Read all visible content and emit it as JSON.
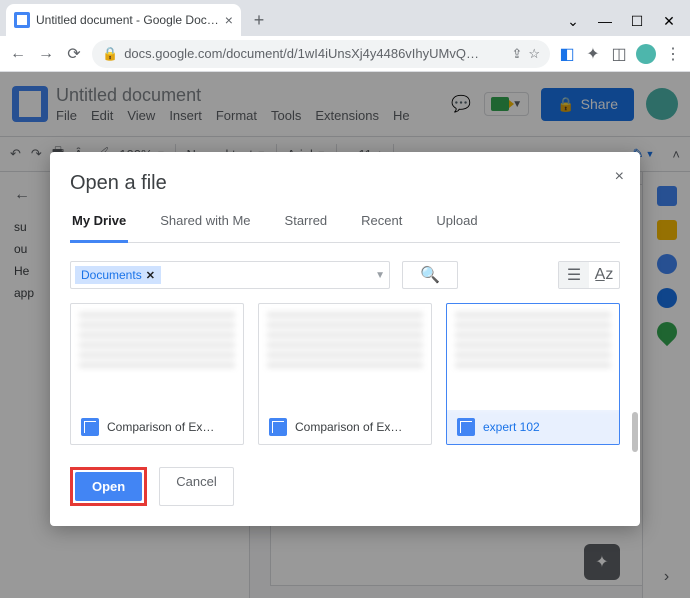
{
  "browser": {
    "tab_title": "Untitled document - Google Doc…",
    "url": "docs.google.com/document/d/1wI4iUnsXj4y4486vIhyUMvQ…"
  },
  "docs": {
    "title": "Untitled document",
    "menu": [
      "File",
      "Edit",
      "View",
      "Insert",
      "Format",
      "Tools",
      "Extensions",
      "He"
    ],
    "share_label": "Share",
    "toolbar": {
      "zoom": "100%",
      "style": "Normal text",
      "font": "Arial",
      "size": "11"
    }
  },
  "outline": {
    "items": [
      "su",
      "ou",
      "He",
      "app"
    ]
  },
  "picker": {
    "title": "Open a file",
    "tabs": [
      "My Drive",
      "Shared with Me",
      "Starred",
      "Recent",
      "Upload"
    ],
    "active_tab": "My Drive",
    "filter_chip": "Documents",
    "files": [
      {
        "name": "Comparison of Ex…",
        "selected": false
      },
      {
        "name": "Comparison of Ex…",
        "selected": false
      },
      {
        "name": "expert 102",
        "selected": true
      }
    ],
    "open_label": "Open",
    "cancel_label": "Cancel"
  }
}
